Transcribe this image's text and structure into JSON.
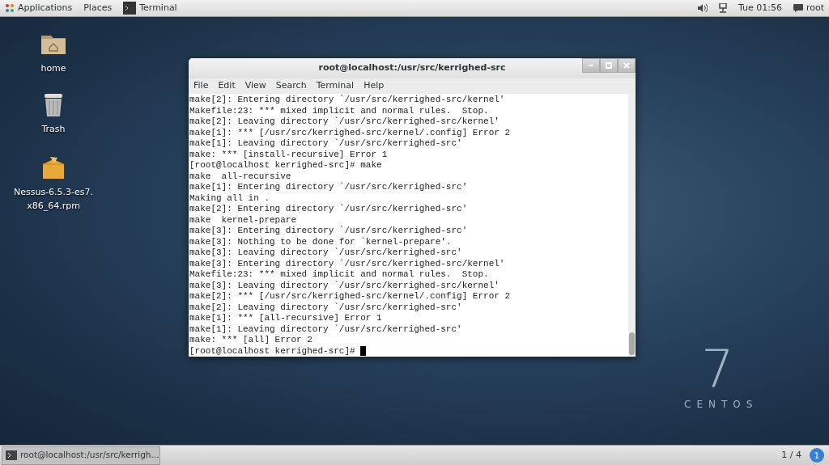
{
  "top_bar": {
    "menus": [
      {
        "label": "Applications",
        "kind": "apps"
      },
      {
        "label": "Places",
        "kind": "plain"
      }
    ],
    "task": {
      "label": "Terminal"
    },
    "clock": "Tue 01:56",
    "user": "root"
  },
  "desktop_icons": [
    {
      "label": "home",
      "kind": "folder"
    },
    {
      "label": "Trash",
      "kind": "trash"
    },
    {
      "label": "Nessus-6.5.3-es7.\nx86_64.rpm",
      "kind": "package"
    }
  ],
  "wallpaper": {
    "number": "7",
    "brand": "CENTOS"
  },
  "terminal": {
    "title": "root@localhost:/usr/src/kerrighed-src",
    "menu": [
      "File",
      "Edit",
      "View",
      "Search",
      "Terminal",
      "Help"
    ],
    "lines": [
      "make[2]: Entering directory `/usr/src/kerrighed-src/kernel'",
      "Makefile:23: *** mixed implicit and normal rules.  Stop.",
      "make[2]: Leaving directory `/usr/src/kerrighed-src/kernel'",
      "make[1]: *** [/usr/src/kerrighed-src/kernel/.config] Error 2",
      "make[1]: Leaving directory `/usr/src/kerrighed-src'",
      "make: *** [install-recursive] Error 1",
      "[root@localhost kerrighed-src]# make",
      "make  all-recursive",
      "make[1]: Entering directory `/usr/src/kerrighed-src'",
      "Making all in .",
      "make[2]: Entering directory `/usr/src/kerrighed-src'",
      "make  kernel-prepare",
      "make[3]: Entering directory `/usr/src/kerrighed-src'",
      "make[3]: Nothing to be done for `kernel-prepare'.",
      "make[3]: Leaving directory `/usr/src/kerrighed-src'",
      "make[3]: Entering directory `/usr/src/kerrighed-src/kernel'",
      "Makefile:23: *** mixed implicit and normal rules.  Stop.",
      "make[3]: Leaving directory `/usr/src/kerrighed-src/kernel'",
      "make[2]: *** [/usr/src/kerrighed-src/kernel/.config] Error 2",
      "make[2]: Leaving directory `/usr/src/kerrighed-src'",
      "make[1]: *** [all-recursive] Error 1",
      "make[1]: Leaving directory `/usr/src/kerrighed-src'",
      "make: *** [all] Error 2",
      "[root@localhost kerrighed-src]# "
    ]
  },
  "bottom_bar": {
    "task": {
      "label": "root@localhost:/usr/src/kerrigh..."
    },
    "workspace": "1 / 4",
    "notifications": "1"
  }
}
